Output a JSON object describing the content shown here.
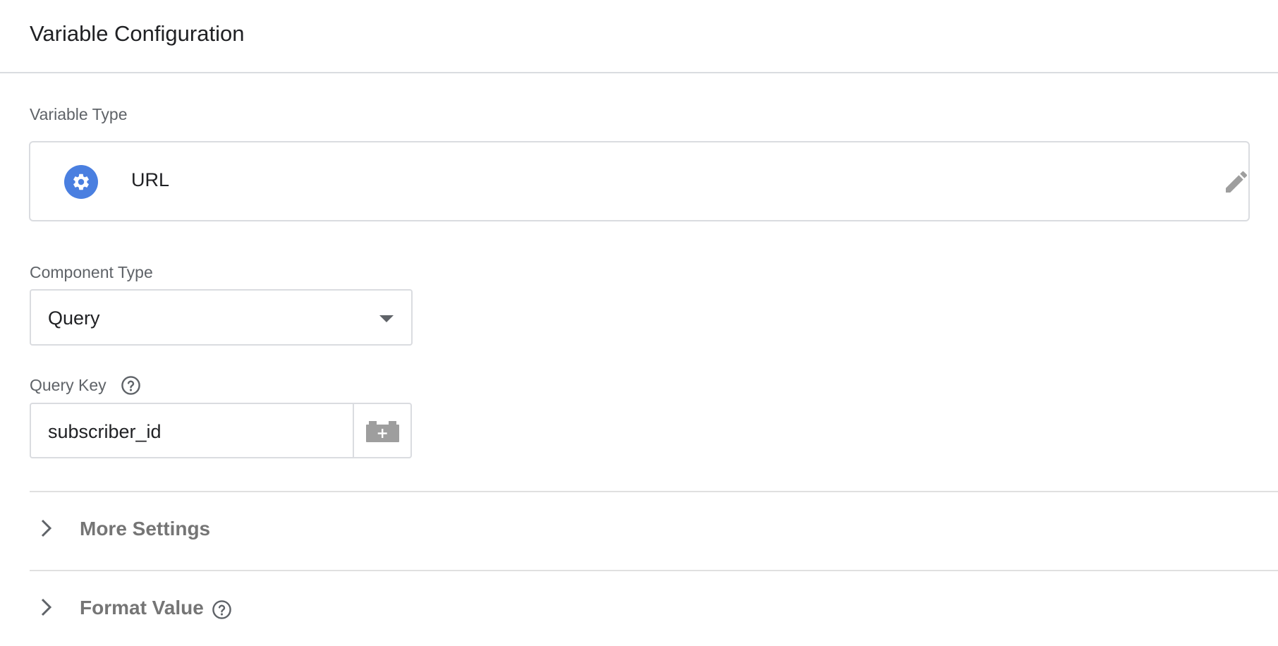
{
  "header": {
    "title": "Variable Configuration"
  },
  "variable_type": {
    "label": "Variable Type",
    "name": "URL",
    "icon": "gear-icon",
    "icon_color": "#4a7fe0",
    "edit_icon": "pencil-icon"
  },
  "component_type": {
    "label": "Component Type",
    "selected": "Query"
  },
  "query_key": {
    "label": "Query Key",
    "value": "subscriber_id",
    "help_icon": "help-circle-icon",
    "picker_icon": "add-variable-brick-icon"
  },
  "sections": {
    "more_settings": {
      "label": "More Settings"
    },
    "format_value": {
      "label": "Format Value"
    }
  },
  "colors": {
    "accent": "#4a7fe0",
    "border": "#dadce0",
    "muted_text": "#5f6368",
    "section_text": "#757575"
  }
}
